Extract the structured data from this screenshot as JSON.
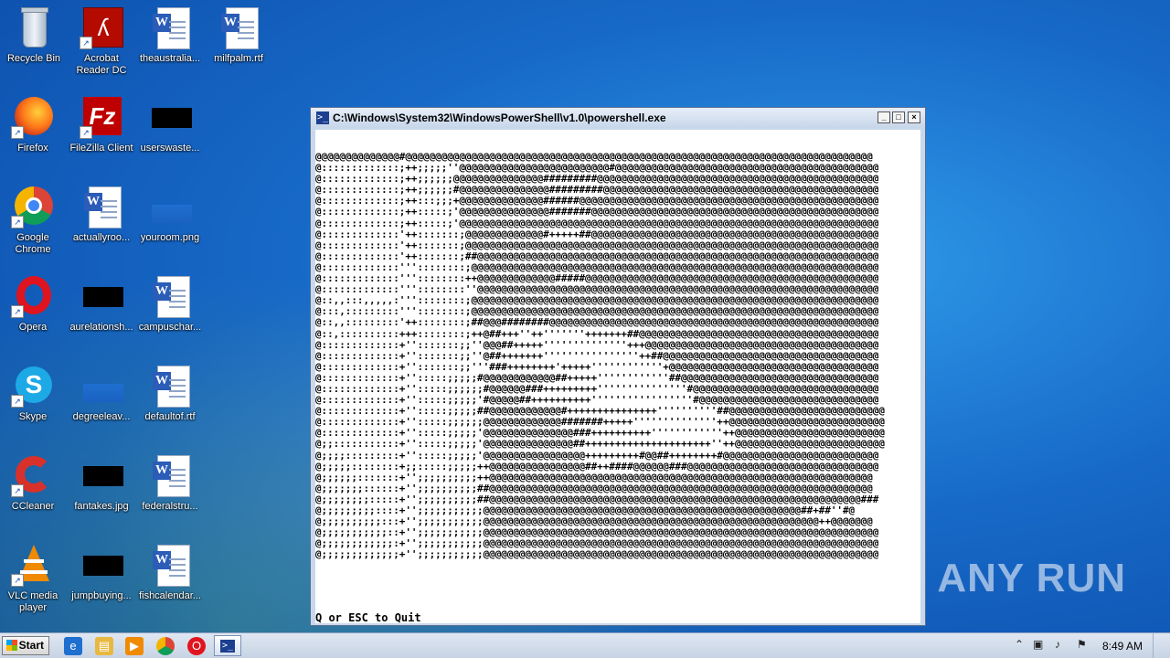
{
  "desktop": {
    "icons": [
      {
        "label": "Recycle Bin"
      },
      {
        "label": "Acrobat Reader DC"
      },
      {
        "label": "theaustralia..."
      },
      {
        "label": "milfpalm.rtf"
      },
      {
        "label": "Firefox"
      },
      {
        "label": "FileZilla Client"
      },
      {
        "label": "userswaste..."
      },
      {
        "label": "Google Chrome"
      },
      {
        "label": "actuallyroo..."
      },
      {
        "label": "youroom.png"
      },
      {
        "label": "Opera"
      },
      {
        "label": "aurelationsh..."
      },
      {
        "label": "campuschar..."
      },
      {
        "label": "Skype"
      },
      {
        "label": "degreeleav..."
      },
      {
        "label": "defaultof.rtf"
      },
      {
        "label": "CCleaner"
      },
      {
        "label": "fantakes.jpg"
      },
      {
        "label": "federalstru..."
      },
      {
        "label": "VLC media player"
      },
      {
        "label": "jumpbuying..."
      },
      {
        "label": "fishcalendar..."
      }
    ],
    "watermark_text": "ANY RUN"
  },
  "window": {
    "title": "C:\\Windows\\System32\\WindowsPowerShell\\v1.0\\powershell.exe",
    "ascii_art": "@@@@@@@@@@@@@@#@@@@@@@@@@@@@@@@@@@@@@@@@@@@@@@@@@@@@@@@@@@@@@@@@@@@@@@@@@@@@@@@@@@@@@@@@@@@@@\n@:::::::::::::;++;;;;;''@@@@@@@@@@@@@@@@@@@@@@@@@#@@@@@@@@@@@@@@@@@@@@@@@@@@@@@@@@@@@@@@@@@@@@\n@:::::::::::::;++;;;;;;@@@@@@@@@@@@@@@#########@@@@@@@@@@@@@@@@@@@@@@@@@@@@@@@@@@@@@@@@@@@@@@@\n@:::::::::::::;++;;;;;;#@@@@@@@@@@@@@@@#########@@@@@@@@@@@@@@@@@@@@@@@@@@@@@@@@@@@@@@@@@@@@@@\n@:::::::::::::;++:::;;;+@@@@@@@@@@@@@@######@@@@@@@@@@@@@@@@@@@@@@@@@@@@@@@@@@@@@@@@@@@@@@@@@@\n@:::::::::::::;++:::::;'@@@@@@@@@@@@@@@#######@@@@@@@@@@@@@@@@@@@@@@@@@@@@@@@@@@@@@@@@@@@@@@@@\n@:::::::::::::;++:::::;'@@@@@@@@@@@@@@@@@@@@@@@@@@@@@@@@@@@@@@@@@@@@@@@@@@@@@@@@@@@@@@@@@@@@@@\n@:::::::::::::'++:::::::;@@@@@@@@@@@@@#+++++##@@@@@@@@@@@@@@@@@@@@@@@@@@@@@@@@@@@@@@@@@@@@@@@@\n@:::::::::::::'++:::::::;@@@@@@@@@@@@@@@@@@@@@@@@@@@@@@@@@@@@@@@@@@@@@@@@@@@@@@@@@@@@@@@@@@@@@\n@:::::::::::::'++:::::::;##@@@@@@@@@@@@@@@@@@@@@@@@@@@@@@@@@@@@@@@@@@@@@@@@@@@@@@@@@@@@@@@@@@@\n@:::::::::::::'''::::::::;@@@@@@@@@@@@@@@@@@@@@@@@@@@@@@@@@@@@@@@@@@@@@@@@@@@@@@@@@@@@@@@@@@@@\n@:::::::::::::'''::::::::++@@@@@@@@@@@@@#####@@@@@@@@@@@@@@@@@@@@@@@@@@@@@@@@@@@@@@@@@@@@@@@@@\n@:::::::::::::'''::::::::''@@@@@@@@@@@@@@@@@@@@@@@@@@@@@@@@@@@@@@@@@@@@@@@@@@@@@@@@@@@@@@@@@@@\n@::,,:::,,,,,:'''::::::::;@@@@@@@@@@@@@@@@@@@@@@@@@@@@@@@@@@@@@@@@@@@@@@@@@@@@@@@@@@@@@@@@@@@@\n@:::,:::::::::'''::::::::;@@@@@@@@@@@@@@@@@@@@@@@@@@@@@@@@@@@@@@@@@@@@@@@@@@@@@@@@@@@@@@@@@@@@\n@::,,:::::::::'++::::::::;##@@@########@@@@@@@@@@@@@@@@@@@@@@@@@@@@@@@@@@@@@@@@@@@@@@@@@@@@@@@\n@::,::::::::::+++::::::::;++@##+++''++'''''''+++++++##@@@@@@@@@@@@@@@@@@@@@@@@@@@@@@@@@@@@@@@@\n@:::::::::::::+'':::::::;;''@@@##+++++''''''''''''''+++@@@@@@@@@@@@@@@@@@@@@@@@@@@@@@@@@@@@@@@\n@:::::::::::::+'':::::::;;''@##+++++++''''''''''''''''++##@@@@@@@@@@@@@@@@@@@@@@@@@@@@@@@@@@@@\n@:::::::::::::+'':::::::;;'''###++++++++'+++++''''''''''''+@@@@@@@@@@@@@@@@@@@@@@@@@@@@@@@@@@@\n@:::::::::::::+'':::::;;;;;#@@@@@@@@@@@@##+++++''''''''''''##@@@@@@@@@@@@@@@@@@@@@@@@@@@@@@@@@\n@:::::::::::::+'':::::;;;;;;#@@@@@@###+++++++++'''''''''''''''#@@@@@@@@@@@@@@@@@@@@@@@@@@@@@@@\n@:::::::::::::+'':::::;;;;;'#@@@@@##++++++++++'''''''''''''''''#@@@@@@@@@@@@@@@@@@@@@@@@@@@@@@\n@:::::::::::::+'':::::;;;;;##@@@@@@@@@@@@#+++++++++++++++''''''''''##@@@@@@@@@@@@@@@@@@@@@@@@@@\n@:::::::::::::+'':::::;;;;;;@@@@@@@@@@@@@#######+++++''''''''''''''++@@@@@@@@@@@@@@@@@@@@@@@@@@\n@:::::::::::::+'':::::;;;;;'@@@@@@@@@@@@@@@###++++++++++''''''''''''++@@@@@@@@@@@@@@@@@@@@@@@@@\n@;;:::::::::::+'':::::;;;;;'@@@@@@@@@@@@@@@##+++++++++++++++++++++''++@@@@@@@@@@@@@@@@@@@@@@@@@\n@;;;;:::::::::+'':::::;;;;;'@@@@@@@@@@@@@@@@@+++++++++#@@##++++++++#@@@@@@@@@@@@@@@@@@@@@@@@@@\n@;;;;;::::::::+;;:::::;;;;;++@@@@@@@@@@@@@@@@##++####@@@@@@###@@@@@@@@@@@@@@@@@@@@@@@@@@@@@@@@\n@;;;;;;:::::::+'';;;;;;;;;;++@@@@@@@@@@@@@@@@@@@@@@@@@@@@@@@@@@@@@@@@@@@@@@@@@@@@@@@@@@@@@@@@\n@;;;;;;;::::::+'';;;;;;;;;;##@@@@@@@@@@@@@@@@@@@@@@@@@@@@@@@@@@@@@@@@@@@@@@@@@@@@@@@@@@@@@@@@\n@;;;;;;;;:::::+'';;;;;;;;;;##@@@@@@@@@@@@@@@@@@@@@@@@@@@@@@@@@@@@@@@@@@@@@@@@@@@@@@@@@@@@@@###\n@;;;;;;;;;::::+'';;;;;;;;;;;@@@@@@@@@@@@@@@@@@@@@@@@@@@@@@@@@@@@@@@@@@@@@@@@@@@@@##+##''#@\n@;;;;;;;;;;:::+'';;;;;;;;;;;@@@@@@@@@@@@@@@@@@@@@@@@@@@@@@@@@@@@@@@@@@@@@@@@@@@@@@@@++@@@@@@@\n@;;;;;;;;;;;::+'';;;;;;;;;;;@@@@@@@@@@@@@@@@@@@@@@@@@@@@@@@@@@@@@@@@@@@@@@@@@@@@@@@@@@@@@@@@@@\n@;;;;;;;;;;;;:+'';;;;;;;;;;;@@@@@@@@@@@@@@@@@@@@@@@@@@@@@@@@@@@@@@@@@@@@@@@@@@@@@@@@@@@@@@@@@@\n@;;;;;;;;;;;;;+'';;;;;;;;;;;@@@@@@@@@@@@@@@@@@@@@@@@@@@@@@@@@@@@@@@@@@@@@@@@@@@@@@@@@@@@@@@@@@",
    "status_line": "Q or ESC to Quit",
    "buttons": {
      "minimize": "_",
      "maximize": "□",
      "close": "×"
    }
  },
  "taskbar": {
    "start_label": "Start",
    "clock": "8:49 AM",
    "pinned": [
      "internet-explorer",
      "file-explorer",
      "media-player",
      "chrome",
      "opera",
      "powershell"
    ]
  }
}
